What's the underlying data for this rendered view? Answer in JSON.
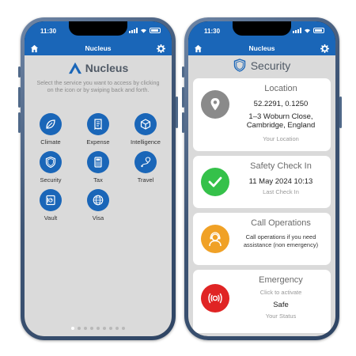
{
  "colors": {
    "brand": "#1a66b8",
    "background": "#dadada",
    "location_icon": "#8a8a8a",
    "checkin_icon": "#35c14a",
    "operations_icon": "#f0a126",
    "emergency_icon": "#e02424"
  },
  "left_phone": {
    "status_time": "11:30",
    "nav_title": "Nucleus",
    "logo_text": "Nucleus",
    "intro": "Select the service you want to access by clicking on the icon or by swiping back and forth.",
    "services": [
      {
        "label": "Climate",
        "icon": "leaf-icon"
      },
      {
        "label": "Expense",
        "icon": "receipt-icon"
      },
      {
        "label": "Intelligence",
        "icon": "cube-icon"
      },
      {
        "label": "Security",
        "icon": "shield-icon"
      },
      {
        "label": "Tax",
        "icon": "calculator-icon"
      },
      {
        "label": "Travel",
        "icon": "route-icon"
      },
      {
        "label": "Vault",
        "icon": "vault-icon"
      },
      {
        "label": "Visa",
        "icon": "globe-icon"
      }
    ],
    "page_dots": 9,
    "active_dot": 0
  },
  "right_phone": {
    "status_time": "11:30",
    "nav_title": "Nucleus",
    "section_title": "Security",
    "location": {
      "title": "Location",
      "coords": "52.2291, 0.1250",
      "address_line1": "1–3 Woburn Close,",
      "address_line2": "Cambridge, England",
      "caption": "Your Location"
    },
    "checkin": {
      "title": "Safety Check In",
      "datetime": "11 May 2024 10:13",
      "caption": "Last Check In"
    },
    "operations": {
      "title": "Call Operations",
      "body_line1": "Call operations if you need",
      "body_line2": "assistance (non emergency)"
    },
    "emergency": {
      "title": "Emergency",
      "hint": "Click to activate",
      "status": "Safe",
      "caption": "Your Status"
    }
  }
}
